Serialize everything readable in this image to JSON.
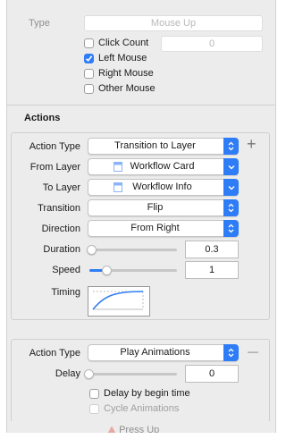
{
  "trigger": {
    "type_label": "Type",
    "type_value": "Mouse Up",
    "click_count_label": "Click Count",
    "click_count_checked": false,
    "click_count_value": "0",
    "options": [
      {
        "label": "Left Mouse",
        "checked": true
      },
      {
        "label": "Right Mouse",
        "checked": false
      },
      {
        "label": "Other Mouse",
        "checked": false
      }
    ]
  },
  "actions_section": {
    "title": "Actions"
  },
  "action1": {
    "action_type_label": "Action Type",
    "action_type_value": "Transition to Layer",
    "add_symbol": "+",
    "from_layer_label": "From Layer",
    "from_layer_value": "Workflow Card",
    "to_layer_label": "To Layer",
    "to_layer_value": "Workflow Info",
    "transition_label": "Transition",
    "transition_value": "Flip",
    "direction_label": "Direction",
    "direction_value": "From Right",
    "duration_label": "Duration",
    "duration_value": "0.3",
    "duration_level": 0.03,
    "speed_label": "Speed",
    "speed_value": "1",
    "speed_level": 0.2,
    "timing_label": "Timing"
  },
  "action2": {
    "action_type_label": "Action Type",
    "action_type_value": "Play Animations",
    "remove_symbol": "—",
    "delay_label": "Delay",
    "delay_value": "0",
    "delay_level": 0.0,
    "delay_by_begin_label": "Delay by begin time",
    "delay_by_begin_checked": false,
    "cycle_label": "Cycle Animations",
    "cycle_checked": false
  },
  "footer": {
    "next_trigger_label": "Press Up"
  },
  "colors": {
    "accent": "#2f7df6",
    "panel": "#ececec"
  }
}
